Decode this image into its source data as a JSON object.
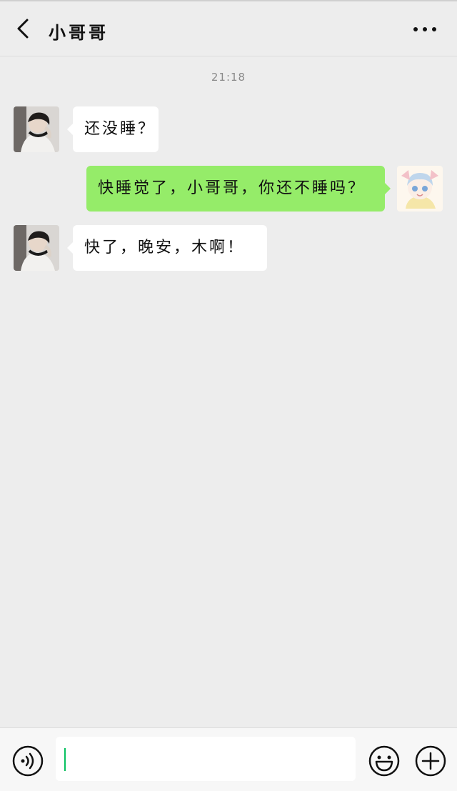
{
  "header": {
    "title": "小哥哥",
    "back_icon": "chevron-left-icon",
    "more_icon": "ellipsis-icon"
  },
  "chat": {
    "timestamp": "21:18",
    "messages": [
      {
        "side": "left",
        "text": "还没睡？"
      },
      {
        "side": "right",
        "text": "快睡觉了，小哥哥，你还不睡吗？"
      },
      {
        "side": "left",
        "text": "快了，晚安，木啊！"
      }
    ]
  },
  "input_bar": {
    "voice_icon": "voice-icon",
    "emoji_icon": "emoji-icon",
    "plus_icon": "plus-icon",
    "value": ""
  },
  "colors": {
    "background": "#ededed",
    "bubble_self": "#95ec69",
    "bubble_other": "#ffffff",
    "caret": "#07c160"
  }
}
